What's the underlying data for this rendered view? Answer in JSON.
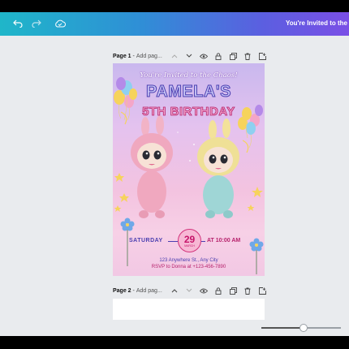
{
  "toolbar": {
    "undo_icon": "undo-icon",
    "redo_icon": "redo-icon",
    "cloud_icon": "cloud-saved-icon",
    "document_title": "You're Invited to the Cha"
  },
  "pages": [
    {
      "label": "Page 1",
      "separator": " - ",
      "title_placeholder": "Add pag...",
      "actions": [
        "chevron-up-icon",
        "chevron-down-icon",
        "eye-icon",
        "lock-icon",
        "copy-icon",
        "trash-icon",
        "add-page-icon"
      ],
      "invitation": {
        "subtitle": "You're Invited to the Chaos!",
        "name": "PAMELA'S",
        "birthday": "5TH BIRTHDAY",
        "day": "SATURDAY",
        "date_number": "29",
        "date_month": "MARCH",
        "time": "AT 10:00 AM",
        "address": "123 Anywhere St., Any City",
        "rsvp": "RSVP to Donna at +123-456-7890"
      }
    },
    {
      "label": "Page 2",
      "separator": " - ",
      "title_placeholder": "Add pag...",
      "actions": [
        "chevron-up-icon",
        "chevron-down-icon",
        "eye-icon",
        "lock-icon",
        "copy-icon",
        "trash-icon",
        "add-page-icon"
      ]
    }
  ],
  "zoom": {
    "level_fraction": 0.53
  },
  "colors": {
    "toolbar_gradient_start": "#1fb6c9",
    "toolbar_gradient_end": "#7a4fe6",
    "canvas_bg": "#e9ebee",
    "accent_purple": "#4b3fb0",
    "accent_pink": "#b7226c"
  }
}
